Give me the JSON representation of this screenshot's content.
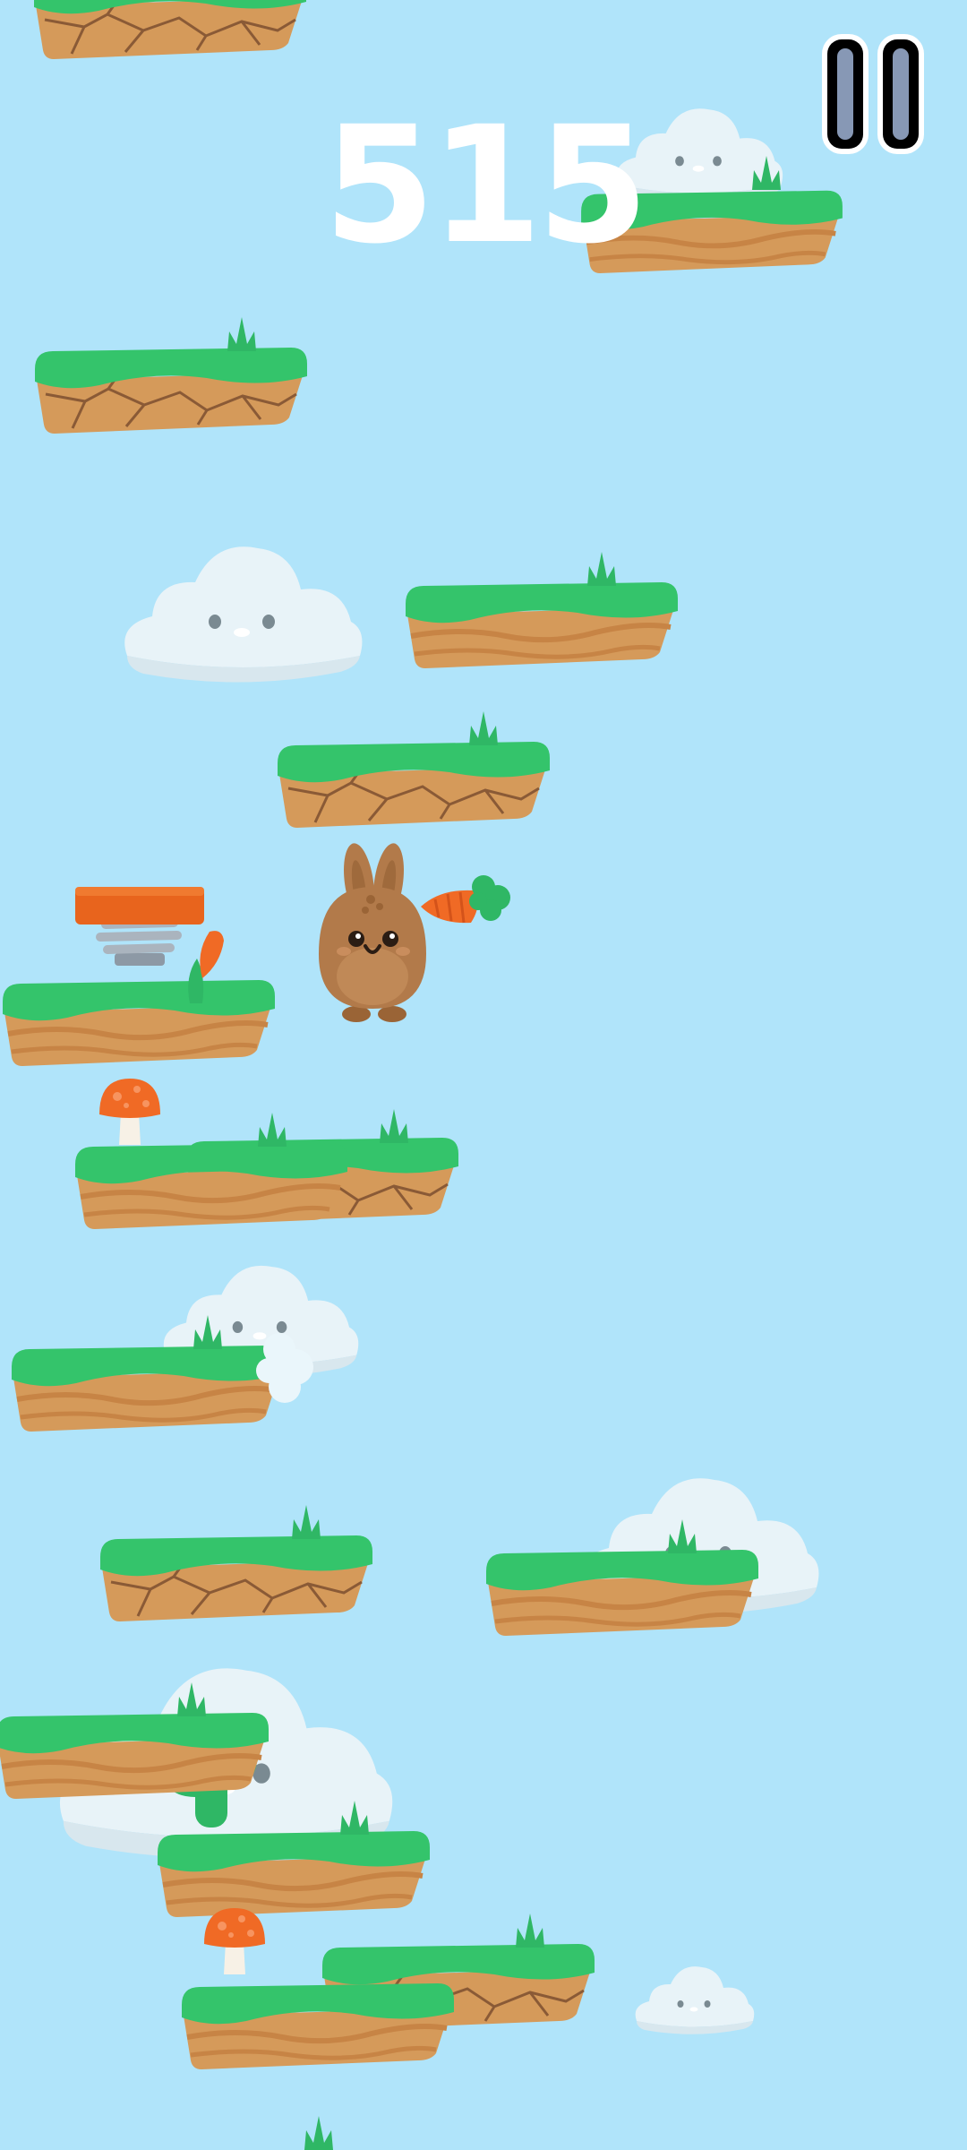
{
  "hud": {
    "score": "515",
    "pause_icon": "pause-icon"
  },
  "colors": {
    "sky": "#b0e4fa",
    "grass": "#34c46b",
    "dirt": "#d59a5a",
    "cloud": "#e8f3f8",
    "bunny": "#b27a4a",
    "carrot": "#f06a25",
    "spring_pad": "#e8641d"
  },
  "sprites": {
    "player": "bunny-character",
    "collectible": "carrot-icon",
    "powerup": "spring-trampoline",
    "hazard": "mushroom-icon",
    "decor": "cloud-face"
  }
}
